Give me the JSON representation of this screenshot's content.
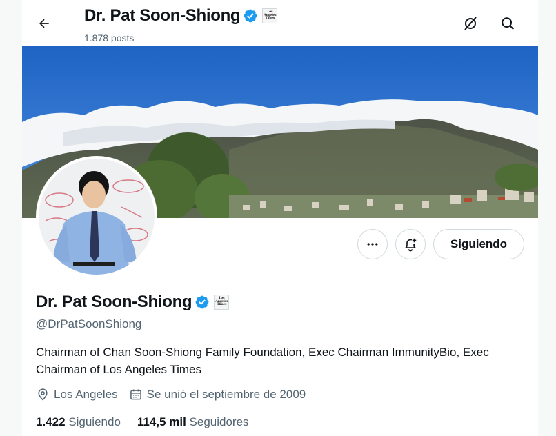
{
  "header": {
    "name": "Dr. Pat Soon-Shiong",
    "posts": "1.878 posts"
  },
  "affiliation": {
    "line1": "Los",
    "line2": "Angeles",
    "line3": "Times"
  },
  "profile": {
    "name": "Dr. Pat Soon-Shiong",
    "handle": "@DrPatSoonShiong",
    "bio": "Chairman of Chan Soon-Shiong Family Foundation, Exec Chairman ImmunityBio, Exec Chairman of Los Angeles Times",
    "location": "Los Angeles",
    "joined": "Se unió el septiembre de 2009"
  },
  "actions": {
    "follow_label": "Siguiendo"
  },
  "stats": {
    "following_count": "1.422",
    "following_label": "Siguiendo",
    "followers_count": "114,5 mil",
    "followers_label": "Seguidores"
  },
  "colors": {
    "verified": "#1d9bf0",
    "text": "#0f1419",
    "secondary": "#536471",
    "border": "#cfd9de"
  },
  "icons": [
    "back-arrow-icon",
    "verified-badge-icon",
    "grok-icon",
    "search-icon",
    "more-icon",
    "notification-add-icon",
    "location-icon",
    "calendar-icon"
  ]
}
